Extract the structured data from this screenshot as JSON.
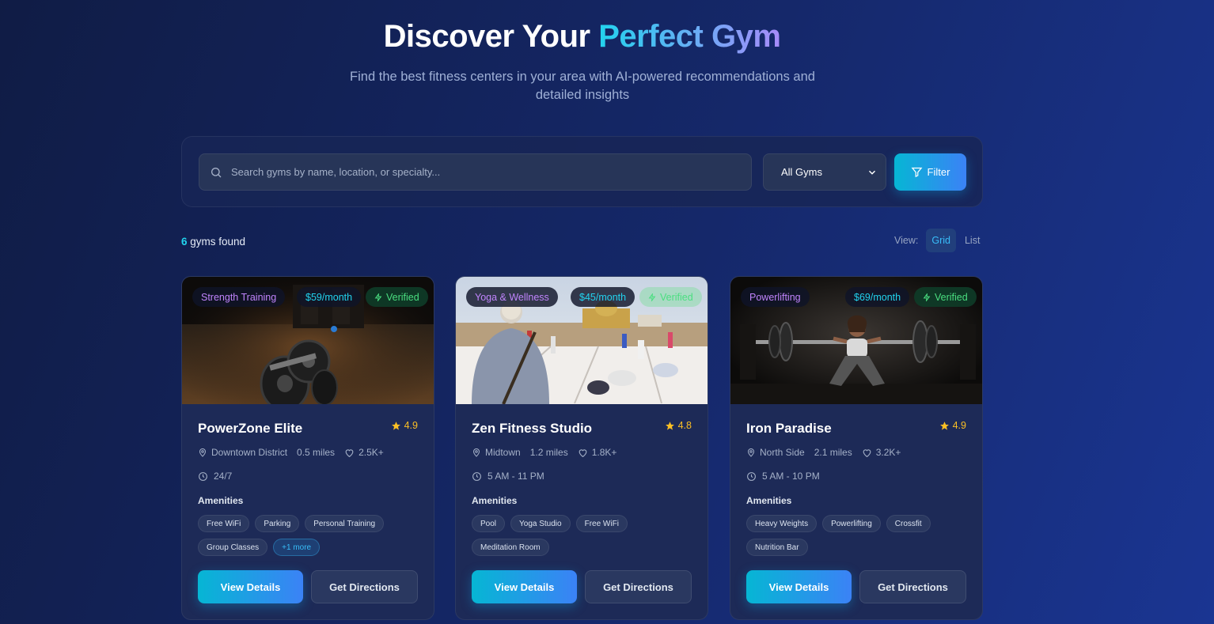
{
  "hero": {
    "title_main": "Discover Your ",
    "title_accent": "Perfect Gym",
    "subtitle": "Find the best fitness centers in your area with AI-powered recommendations and detailed insights"
  },
  "search": {
    "placeholder": "Search gyms by name, location, or specialty...",
    "select_value": "All Gyms",
    "filter_label": "Filter"
  },
  "results": {
    "count": "6",
    "suffix": " gyms found"
  },
  "view": {
    "label": "View:",
    "grid": "Grid",
    "list": "List"
  },
  "colors": {
    "accent_cyan": "#22d3ee",
    "accent_purple": "#a78bfa",
    "verified_green": "#4ade80",
    "star_yellow": "#fbbf24"
  },
  "cards": [
    {
      "category": "Strength Training",
      "price": "$59/month",
      "verified": "Verified",
      "name": "PowerZone Elite",
      "rating": "4.9",
      "location": "Downtown District",
      "distance": "0.5 miles",
      "likes": "2.5K+",
      "hours": "24/7",
      "amenities_label": "Amenities",
      "amenities": [
        "Free WiFi",
        "Parking",
        "Personal Training",
        "Group Classes"
      ],
      "more": "+1 more",
      "view_label": "View Details",
      "directions_label": "Get Directions"
    },
    {
      "category": "Yoga & Wellness",
      "price": "$45/month",
      "verified": "Verified",
      "name": "Zen Fitness Studio",
      "rating": "4.8",
      "location": "Midtown",
      "distance": "1.2 miles",
      "likes": "1.8K+",
      "hours": "5 AM - 11 PM",
      "amenities_label": "Amenities",
      "amenities": [
        "Pool",
        "Yoga Studio",
        "Free WiFi",
        "Meditation Room"
      ],
      "view_label": "View Details",
      "directions_label": "Get Directions"
    },
    {
      "category": "Powerlifting",
      "price": "$69/month",
      "verified": "Verified",
      "name": "Iron Paradise",
      "rating": "4.9",
      "location": "North Side",
      "distance": "2.1 miles",
      "likes": "3.2K+",
      "hours": "5 AM - 10 PM",
      "amenities_label": "Amenities",
      "amenities": [
        "Heavy Weights",
        "Powerlifting",
        "Crossfit",
        "Nutrition Bar"
      ],
      "view_label": "View Details",
      "directions_label": "Get Directions"
    }
  ]
}
